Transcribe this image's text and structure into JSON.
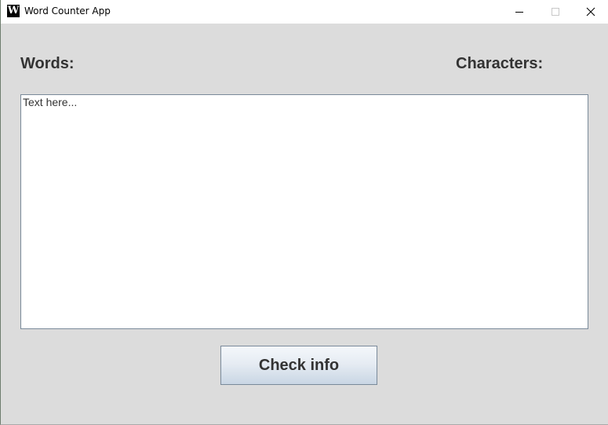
{
  "window": {
    "title": "Word Counter App",
    "icon_letter": "W"
  },
  "labels": {
    "words": "Words:",
    "characters": "Characters:"
  },
  "editor": {
    "placeholder": "Text here...",
    "value": ""
  },
  "actions": {
    "check_label": "Check info"
  },
  "icons": {
    "app": "app-icon",
    "minimize": "minimize-icon",
    "maximize": "maximize-icon",
    "close": "close-icon"
  },
  "colors": {
    "window_bg": "#dcdcdc",
    "label_text": "#333333",
    "button_gradient_top": "#f4f7fb",
    "button_gradient_bottom": "#c9d6e4"
  }
}
